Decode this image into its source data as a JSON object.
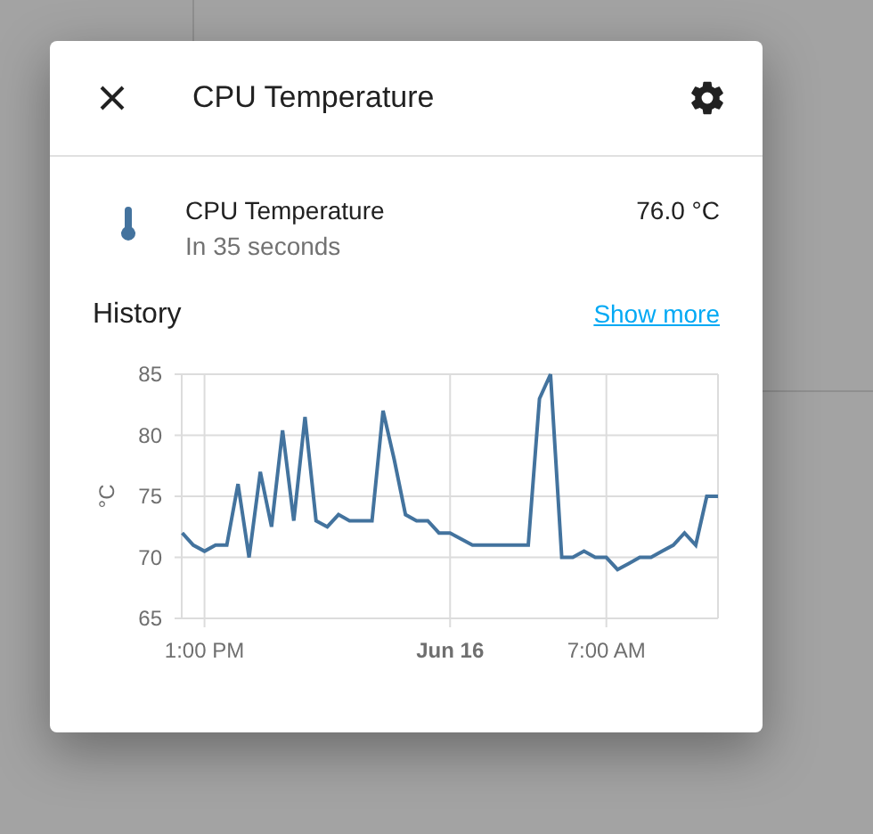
{
  "dialog": {
    "title": "CPU Temperature"
  },
  "entity": {
    "name": "CPU Temperature",
    "subtitle": "In 35 seconds",
    "state": "76.0 °C"
  },
  "history": {
    "title": "History",
    "link": "Show more",
    "chart_data": {
      "type": "line",
      "grid": true,
      "ylabel": "°C",
      "ylim": [
        65,
        85
      ],
      "yticks": [
        65,
        70,
        75,
        80,
        85
      ],
      "categories": [
        null,
        null,
        "1:00 PM",
        null,
        null,
        null,
        null,
        null,
        null,
        null,
        null,
        null,
        null,
        null,
        null,
        null,
        null,
        null,
        null,
        null,
        null,
        null,
        null,
        null,
        "Jun 16",
        null,
        null,
        null,
        null,
        null,
        null,
        null,
        null,
        null,
        null,
        null,
        null,
        null,
        "7:00 AM",
        null,
        null,
        null,
        null,
        null,
        null,
        null,
        null,
        null,
        null
      ],
      "series": [
        {
          "color": "#43739e",
          "values": [
            72,
            71,
            70.5,
            71,
            71,
            76,
            70,
            77,
            72.5,
            80.4,
            73,
            81.5,
            73,
            72.5,
            73.5,
            73,
            73,
            73,
            82,
            78,
            73.5,
            73,
            73,
            72,
            72,
            71.5,
            71,
            71,
            71,
            71,
            71,
            71,
            83,
            85,
            70,
            70,
            70.5,
            70,
            70,
            69,
            69.5,
            70,
            70,
            70.5,
            71,
            72,
            71,
            75,
            75
          ]
        }
      ]
    }
  }
}
